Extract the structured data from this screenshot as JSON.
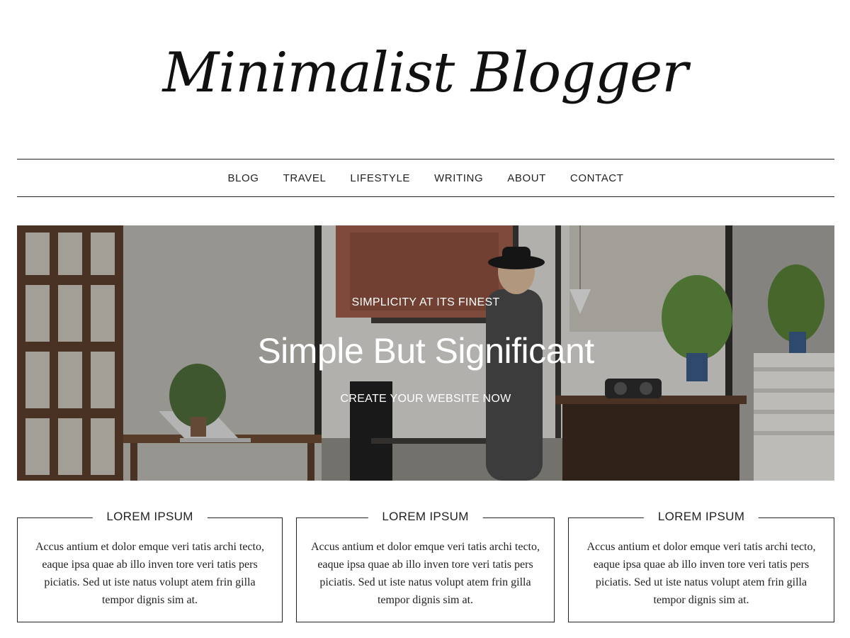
{
  "site": {
    "title": "Minimalist Blogger"
  },
  "nav": {
    "items": [
      "BLOG",
      "TRAVEL",
      "LIFESTYLE",
      "WRITING",
      "ABOUT",
      "CONTACT"
    ]
  },
  "hero": {
    "kicker": "SIMPLICITY AT ITS FINEST",
    "title": "Simple But Significant",
    "cta": "CREATE YOUR WEBSITE NOW"
  },
  "features": [
    {
      "title": "LOREM IPSUM",
      "text": "Accus antium et dolor emque veri tatis archi tecto, eaque ipsa quae ab illo inven tore veri tatis pers piciatis. Sed ut iste natus volupt atem frin gilla tempor dignis sim at."
    },
    {
      "title": "LOREM IPSUM",
      "text": "Accus antium et dolor emque veri tatis archi tecto, eaque ipsa quae ab illo inven tore veri tatis pers piciatis. Sed ut iste natus volupt atem frin gilla tempor dignis sim at."
    },
    {
      "title": "LOREM IPSUM",
      "text": "Accus antium et dolor emque veri tatis archi tecto, eaque ipsa quae ab illo inven tore veri tatis pers piciatis. Sed ut iste natus volupt atem frin gilla tempor dignis sim at."
    }
  ],
  "colors": {
    "text": "#222222",
    "background": "#ffffff",
    "hero_overlay_text": "#ffffff"
  }
}
